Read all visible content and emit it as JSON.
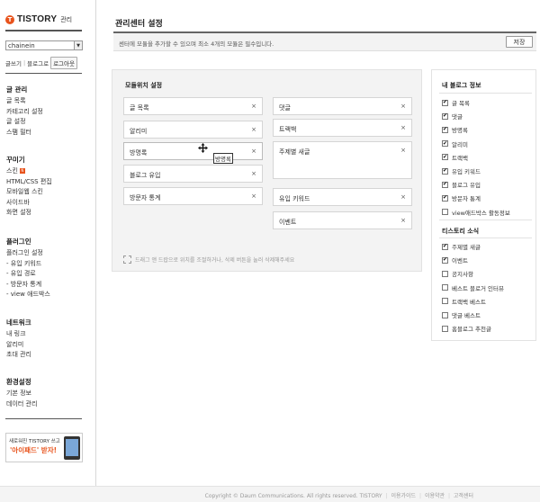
{
  "sidebar": {
    "logo_mark": "T",
    "logo_brand": "TISTORY",
    "logo_sub": "관리",
    "blog_select_value": "chainein",
    "links": {
      "write": "글쓰기",
      "blog": "블로그로",
      "logout": "로그아웃"
    },
    "groups": [
      {
        "title": "글 관리",
        "items": [
          "글 목록",
          "카테고리 설정",
          "글 설정",
          "스팸 필터"
        ]
      },
      {
        "title": "꾸미기",
        "items": [
          "스킨",
          "HTML/CSS 편집",
          "모바일웹 스킨",
          "사이드바",
          "화면 설정"
        ]
      },
      {
        "title": "플러그인",
        "items": [
          "플러그인 설정",
          "- 유입 키워드",
          "- 유입 경로",
          "- 방문자 통계",
          "- view 애드박스"
        ]
      },
      {
        "title": "네트워크",
        "items": [
          "내 링크",
          "알리미",
          "초대 관리"
        ]
      },
      {
        "title": "환경설정",
        "items": [
          "기본 정보",
          "데이터 관리"
        ]
      }
    ],
    "skin_new_badge": "N",
    "ad": {
      "line1": "새로워진 TISTORY 쓰고",
      "line2": "'아이패드' 받자!"
    }
  },
  "main": {
    "title": "관리센터 설정",
    "notice": "센터에 모듈을 추가할 수 있으며 최소 4개의 모듈은 필수입니다.",
    "save_label": "저장",
    "layout_title": "모듈위치 설정",
    "left_modules": [
      "글 목록",
      "알리미",
      "방명록",
      "블로그 유입",
      "방문자 통계"
    ],
    "right_modules": [
      "댓글",
      "트랙백",
      "주제별 새글",
      "유입 키워드",
      "이벤트"
    ],
    "close_glyph": "×",
    "tooltip": "방명록",
    "drag_hint": "드래그 앤 드랍으로 위치를 조절하거나, 삭제 버튼을 눌러 삭제해주세요"
  },
  "info": {
    "my_blog_title": "내 블로그 정보",
    "my_blog_items": [
      {
        "label": "글 목록",
        "checked": true
      },
      {
        "label": "댓글",
        "checked": true
      },
      {
        "label": "방명록",
        "checked": true
      },
      {
        "label": "알리미",
        "checked": true
      },
      {
        "label": "트랙백",
        "checked": true
      },
      {
        "label": "유입 키워드",
        "checked": true
      },
      {
        "label": "블로그 유입",
        "checked": true
      },
      {
        "label": "방문자 통계",
        "checked": true
      },
      {
        "label": "view애드박스 활동정보",
        "checked": false
      }
    ],
    "tistory_title": "티스토리 소식",
    "tistory_items": [
      {
        "label": "주제별 새글",
        "checked": true
      },
      {
        "label": "이벤트",
        "checked": true
      },
      {
        "label": "공지사항",
        "checked": false
      },
      {
        "label": "베스트 블로거 인터뷰",
        "checked": false
      },
      {
        "label": "트랙백 베스트",
        "checked": false
      },
      {
        "label": "댓글 베스트",
        "checked": false
      },
      {
        "label": "홈블로그 추천글",
        "checked": false
      }
    ],
    "check_glyph": "✔"
  },
  "footer": {
    "copyright": "Copyright © Daum Communications. All rights reserved. TISTORY",
    "links": [
      "이용가이드",
      "이용약관",
      "고객센터"
    ]
  }
}
